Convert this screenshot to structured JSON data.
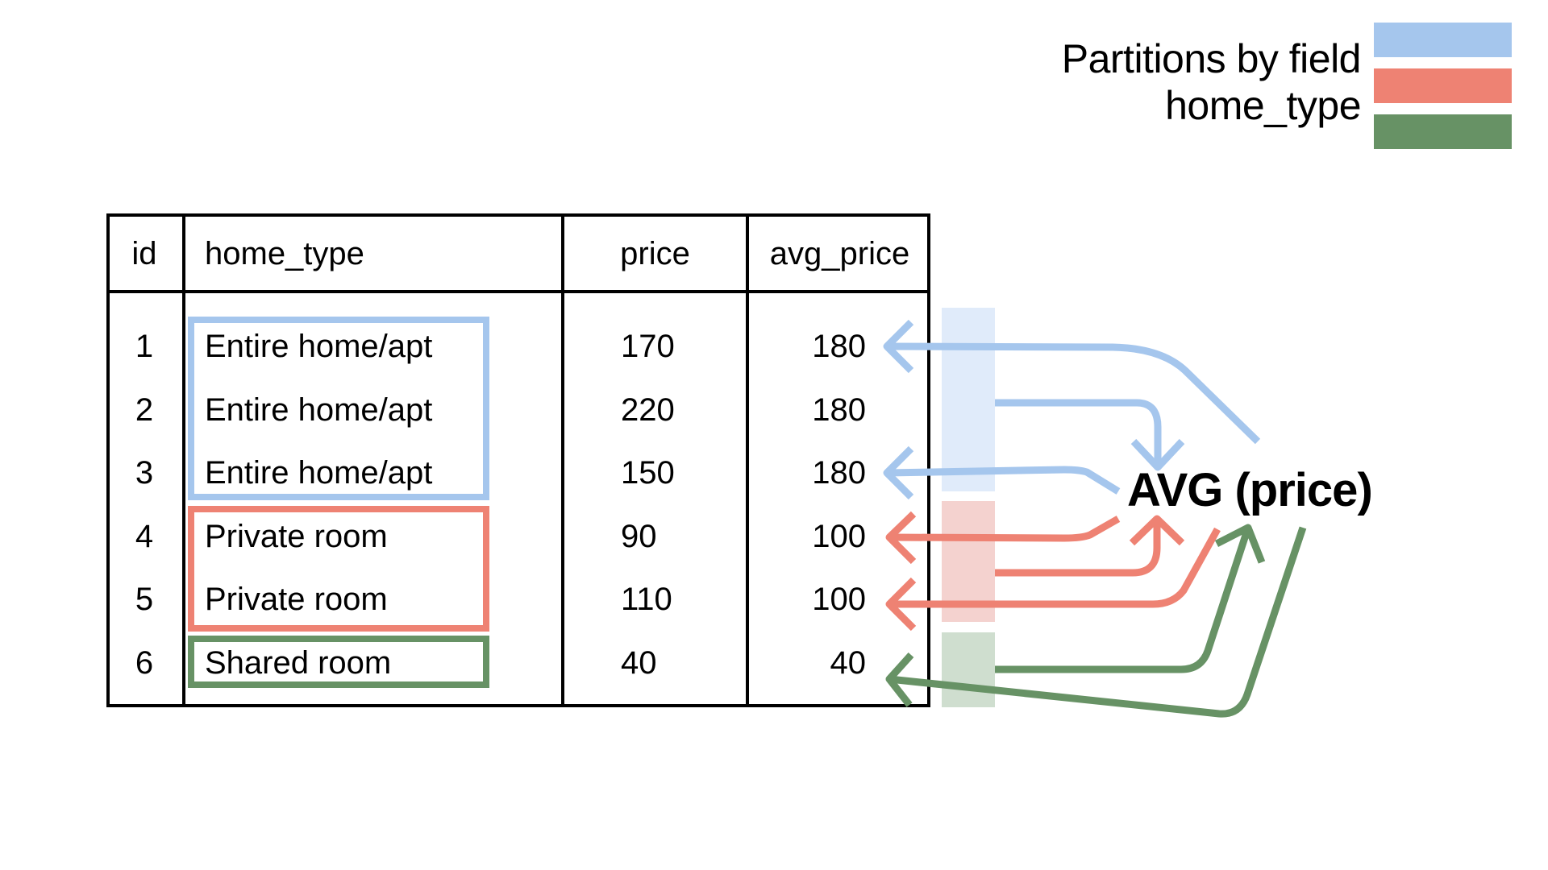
{
  "legend": {
    "title_line1": "Partitions by field",
    "title_line2": "home_type",
    "partitions": [
      {
        "name": "Entire home/apt",
        "color": "#a5c6ed"
      },
      {
        "name": "Private room",
        "color": "#ee8273"
      },
      {
        "name": "Shared room",
        "color": "#679265"
      }
    ]
  },
  "table": {
    "headers": [
      "id",
      "home_type",
      "price",
      "avg_price"
    ],
    "rows": [
      {
        "id": "1",
        "home_type": "Entire home/apt",
        "price": "170",
        "avg_price": "180"
      },
      {
        "id": "2",
        "home_type": "Entire home/apt",
        "price": "220",
        "avg_price": "180"
      },
      {
        "id": "3",
        "home_type": "Entire home/apt",
        "price": "150",
        "avg_price": "180"
      },
      {
        "id": "4",
        "home_type": "Private room",
        "price": "90",
        "avg_price": "100"
      },
      {
        "id": "5",
        "home_type": "Private room",
        "price": "110",
        "avg_price": "100"
      },
      {
        "id": "6",
        "home_type": "Shared room",
        "price": "40",
        "avg_price": "40"
      }
    ]
  },
  "function_label": "AVG (price)",
  "colors": {
    "blue": "#a5c6ed",
    "blue_light": "#e0ebfa",
    "red": "#ee8273",
    "red_light": "#f4d2cf",
    "green": "#679265",
    "green_light": "#cfdecf",
    "ink": "#000000"
  }
}
